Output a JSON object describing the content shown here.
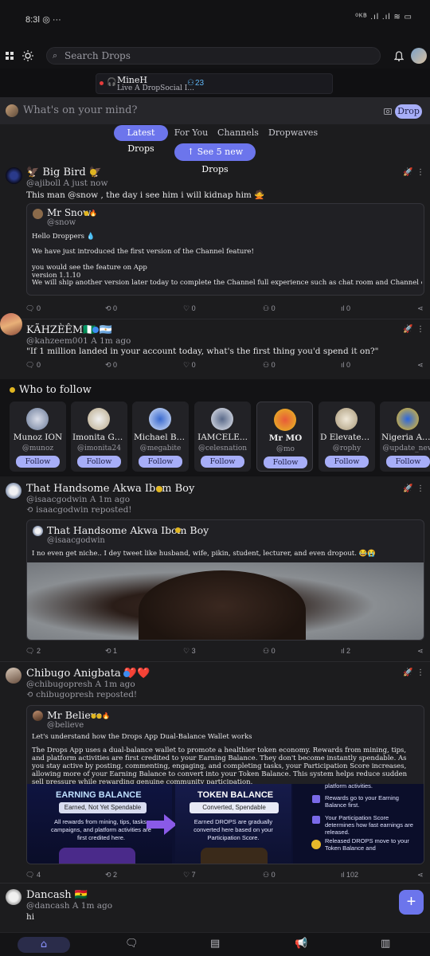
{
  "status": {
    "time": "8:3ǀ ◎ ···",
    "right": "⁰ᴷᴮ .ıl .ıl ≋ ▭"
  },
  "topbar": {
    "search_placeholder": "Search Drops"
  },
  "live": {
    "name": "MineH",
    "subtitle": "Live A DropSocial I...",
    "count": "23"
  },
  "composer": {
    "placeholder": "What's on your mind?",
    "drop_label": "Drop"
  },
  "tabs": [
    {
      "label": "Latest Drops"
    },
    {
      "label": "For You"
    },
    {
      "label": "Channels ›"
    },
    {
      "label": "Dropwaves"
    }
  ],
  "new_drops": "↑ See 5 new Drops",
  "posts": [
    {
      "name": "🦅 Big Bird 🦅",
      "handle": "@ajiboll A just now",
      "text": "This man @snow , the day i see him i will kidnap him 🙅",
      "quote": {
        "name": "Mr Snow",
        "handle": "@snow",
        "lines": [
          "Hello Droppers 💧",
          "We have just introduced the first version of the Channel feature!",
          "you would see the feature on App",
          "version 1.1.10",
          "We will ship another version later today to complete the Channel full experience such as chat room and Channel owner moderation..."
        ]
      },
      "stats": [
        "0",
        "0",
        "0",
        "0",
        "0"
      ]
    },
    {
      "name": "KÃHZÈÊM🇳🇬 🇦🇷",
      "handle": "@kahzeem001 A 1m ago",
      "text": "\"If 1 million landed in your account today, what's the first thing you'd spend it on?\"",
      "stats": [
        "0",
        "0",
        "0",
        "0",
        "0"
      ]
    },
    {
      "name": "That Handsome Akwa Ibom Boy",
      "handle": "@isaacgodwin A 1m ago",
      "repost": "⟲ isaacgodwin reposted!",
      "quote": {
        "name": "That Handsome Akwa Ibom Boy",
        "handle": "@isaacgodwin",
        "lines": [
          "I no even get niche.. I dey tweet like husband, wife, pikin, student, lecturer, and even dropout. 😂😭"
        ]
      },
      "stats": [
        "2",
        "1",
        "3",
        "0",
        "2"
      ]
    },
    {
      "name": "Chibugo Anigbata ❤️❤️",
      "handle": "@chibugopresh A 1m ago",
      "repost": "⟲ chibugopresh reposted!",
      "quote": {
        "name": "Mr Believe",
        "handle": "@believe",
        "lines": [
          "Let's understand how the Drops App Dual-Balance Wallet works",
          "The Drops App uses a dual-balance wallet to promote a healthier token economy. Rewards from mining, tips, and platform activities are first credited to your Earning Balance. They don't become instantly spendable. As you stay active by posting, commenting, engaging, and completing tasks, your Participation Score increases, allowing more of your Earning Balance to convert into your Token Balance. This system helps reduce sudden sell pressure while rewarding genuine community participation."
        ]
      },
      "image": {
        "earning_title": "EARNING BALANCE",
        "earning_sub": "Earned, Not Yet Spendable",
        "earning_text": "All rewards from mining, tips, tasks, campaigns, and platform activities are first credited here.",
        "token_title": "TOKEN BALANCE",
        "token_sub": "Converted, Spendable",
        "token_text": "Earned DROPS are gradually converted here based on your Participation Score.",
        "right_items": [
          "platform activities.",
          "Rewards go to your Earning Balance first.",
          "Your Participation Score determines how fast earnings are released.",
          "Released DROPS move to your Token Balance and"
        ]
      },
      "stats": [
        "4",
        "2",
        "7",
        "0",
        "102"
      ]
    },
    {
      "name": "Dancash 🇬🇭",
      "handle": "@dancash A 1m ago",
      "text": "hi"
    }
  ],
  "who_to_follow": {
    "title": "Who to follow",
    "follow_label": "Follow",
    "users": [
      {
        "name": "Munoz ION",
        "handle": "@munoz"
      },
      {
        "name": "Imonita Go...",
        "handle": "@imonita24"
      },
      {
        "name": "Michael Be...",
        "handle": "@megabite"
      },
      {
        "name": "IAMCELE...",
        "handle": "@celesnation"
      },
      {
        "name": "Mr MO",
        "handle": "@mo"
      },
      {
        "name": "D Elevated 1",
        "handle": "@rophy"
      },
      {
        "name": "Nigeria Am...",
        "handle": "@update_new"
      }
    ]
  },
  "fab": "+",
  "colors": {
    "accent": "#6c75ec",
    "follow_bg": "#a7aef8",
    "bg": "#1c1c1e"
  }
}
